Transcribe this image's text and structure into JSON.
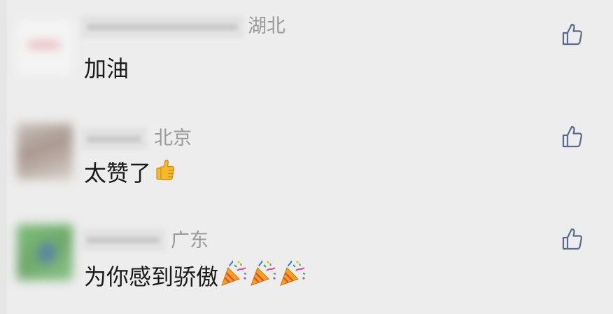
{
  "comments": [
    {
      "location": "湖北",
      "text": "加油",
      "emoji": []
    },
    {
      "location": "北京",
      "text": "太赞了",
      "emoji": [
        "thumbs-up-emoji"
      ]
    },
    {
      "location": "广东",
      "text": "为你感到骄傲",
      "emoji": [
        "party-popper-emoji",
        "party-popper-emoji",
        "party-popper-emoji"
      ]
    }
  ],
  "colors": {
    "background": "#ededed",
    "text": "#1a1a1a",
    "location": "#9a9a9a",
    "like_icon": "#5b6b8c"
  },
  "icons": {
    "like": "thumbs-up-outline-icon",
    "inline_emoji": "thumbs-up-emoji",
    "party": "party-popper-emoji"
  }
}
